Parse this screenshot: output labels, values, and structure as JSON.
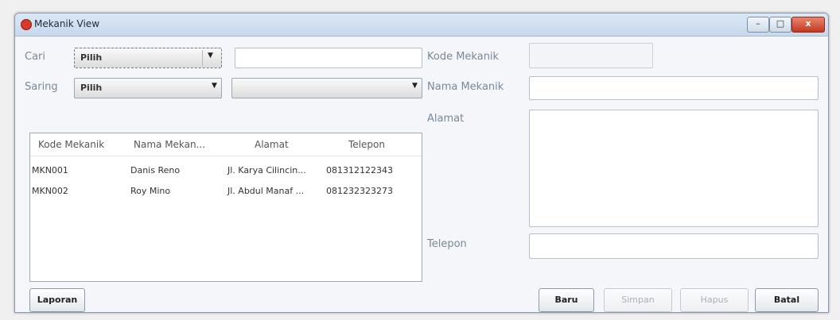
{
  "window": {
    "title": "Mekanik View",
    "minimize": "–",
    "maximize": "□",
    "close": "x"
  },
  "search": {
    "label": "Cari",
    "combo_value": "Pilih",
    "input_value": "",
    "arrow": "▼"
  },
  "filter": {
    "label": "Saring",
    "combo_value": "Pilih",
    "value_combo": "",
    "arrow": "▼"
  },
  "table": {
    "columns": [
      "Kode Mekanik",
      "Nama Mekan...",
      "Alamat",
      "Telepon"
    ],
    "rows": [
      [
        "MKN001",
        "Danis Reno",
        "Jl. Karya Cilincin...",
        "081312122343"
      ],
      [
        "MKN002",
        "Roy Mino",
        "Jl. Abdul Manaf ...",
        "081232323273"
      ]
    ]
  },
  "form": {
    "kode_label": "Kode Mekanik",
    "kode_value": "",
    "nama_label": "Nama Mekanik",
    "nama_value": "",
    "alamat_label": "Alamat",
    "alamat_value": "",
    "telepon_label": "Telepon",
    "telepon_value": ""
  },
  "buttons": {
    "laporan": "Laporan",
    "baru": "Baru",
    "simpan": "Simpan",
    "hapus": "Hapus",
    "batal": "Batal"
  }
}
